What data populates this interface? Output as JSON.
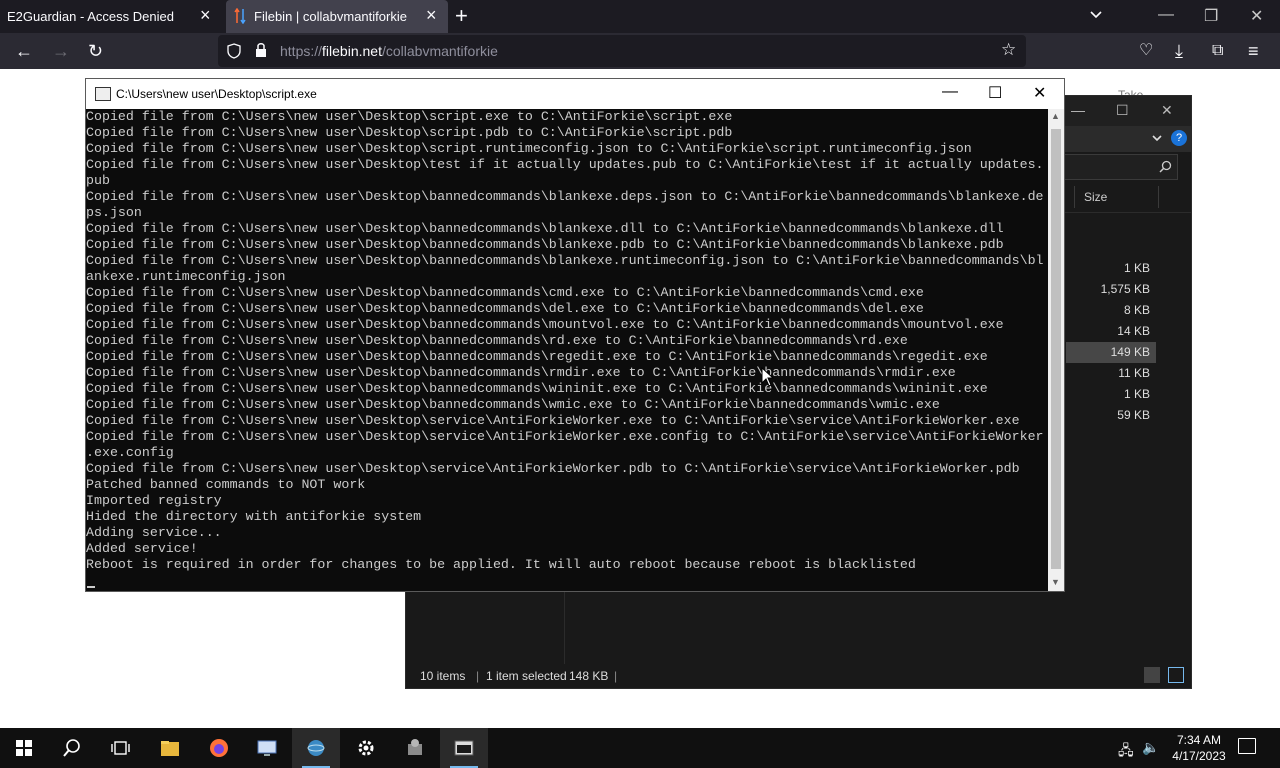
{
  "browser": {
    "tabs": [
      {
        "title": "E2Guardian - Access Denied"
      },
      {
        "title": "Filebin | collabvmantiforkie"
      }
    ],
    "url_prefix": "https://",
    "url_domain": "filebin.net",
    "url_path": "/collabvmantiforkie"
  },
  "background_page": {
    "fragment": "Takе"
  },
  "console": {
    "title": "C:\\Users\\new user\\Desktop\\script.exe",
    "lines": [
      "Copied file from C:\\Users\\new user\\Desktop\\script.exe to C:\\AntiForkie\\script.exe",
      "Copied file from C:\\Users\\new user\\Desktop\\script.pdb to C:\\AntiForkie\\script.pdb",
      "Copied file from C:\\Users\\new user\\Desktop\\script.runtimeconfig.json to C:\\AntiForkie\\script.runtimeconfig.json",
      "Copied file from C:\\Users\\new user\\Desktop\\test if it actually updates.pub to C:\\AntiForkie\\test if it actually updates.",
      "pub",
      "Copied file from C:\\Users\\new user\\Desktop\\bannedcommands\\blankexe.deps.json to C:\\AntiForkie\\bannedcommands\\blankexe.de",
      "ps.json",
      "Copied file from C:\\Users\\new user\\Desktop\\bannedcommands\\blankexe.dll to C:\\AntiForkie\\bannedcommands\\blankexe.dll",
      "Copied file from C:\\Users\\new user\\Desktop\\bannedcommands\\blankexe.pdb to C:\\AntiForkie\\bannedcommands\\blankexe.pdb",
      "Copied file from C:\\Users\\new user\\Desktop\\bannedcommands\\blankexe.runtimeconfig.json to C:\\AntiForkie\\bannedcommands\\bl",
      "ankexe.runtimeconfig.json",
      "Copied file from C:\\Users\\new user\\Desktop\\bannedcommands\\cmd.exe to C:\\AntiForkie\\bannedcommands\\cmd.exe",
      "Copied file from C:\\Users\\new user\\Desktop\\bannedcommands\\del.exe to C:\\AntiForkie\\bannedcommands\\del.exe",
      "Copied file from C:\\Users\\new user\\Desktop\\bannedcommands\\mountvol.exe to C:\\AntiForkie\\bannedcommands\\mountvol.exe",
      "Copied file from C:\\Users\\new user\\Desktop\\bannedcommands\\rd.exe to C:\\AntiForkie\\bannedcommands\\rd.exe",
      "Copied file from C:\\Users\\new user\\Desktop\\bannedcommands\\regedit.exe to C:\\AntiForkie\\bannedcommands\\regedit.exe",
      "Copied file from C:\\Users\\new user\\Desktop\\bannedcommands\\rmdir.exe to C:\\AntiForkie\\bannedcommands\\rmdir.exe",
      "Copied file from C:\\Users\\new user\\Desktop\\bannedcommands\\wininit.exe to C:\\AntiForkie\\bannedcommands\\wininit.exe",
      "Copied file from C:\\Users\\new user\\Desktop\\bannedcommands\\wmic.exe to C:\\AntiForkie\\bannedcommands\\wmic.exe",
      "Copied file from C:\\Users\\new user\\Desktop\\service\\AntiForkieWorker.exe to C:\\AntiForkie\\service\\AntiForkieWorker.exe",
      "Copied file from C:\\Users\\new user\\Desktop\\service\\AntiForkieWorker.exe.config to C:\\AntiForkie\\service\\AntiForkieWorker",
      ".exe.config",
      "Copied file from C:\\Users\\new user\\Desktop\\service\\AntiForkieWorker.pdb to C:\\AntiForkie\\service\\AntiForkieWorker.pdb",
      "Patched banned commands to NOT work",
      "Imported registry",
      "Hided the directory with antiforkie system",
      "Adding service...",
      "Added service!",
      "Reboot is required in order for changes to be applied. It will auto reboot because reboot is blacklisted"
    ]
  },
  "explorer": {
    "size_header": "Size",
    "sizes": [
      "1 KB",
      "1,575 KB",
      "8 KB",
      "14 KB",
      "149 KB",
      "11 KB",
      "1 KB",
      "59 KB"
    ],
    "selected_index": 4,
    "status_items": "10 items",
    "status_selected": "1 item selected",
    "status_size": "148 KB"
  },
  "taskbar": {
    "time": "7:34 AM",
    "date": "4/17/2023",
    "apps": [
      "start-icon",
      "search-icon",
      "task-view-icon",
      "file-explorer-icon",
      "firefox-icon",
      "remote-desktop-icon",
      "network-globe-icon",
      "settings-icon",
      "setup-installer-icon",
      "console-app-icon"
    ]
  },
  "colors": {
    "console_bg": "#0c0c0c",
    "console_text": "#cccccc",
    "browser_dark": "#1c1b22",
    "taskbar": "#101010"
  }
}
